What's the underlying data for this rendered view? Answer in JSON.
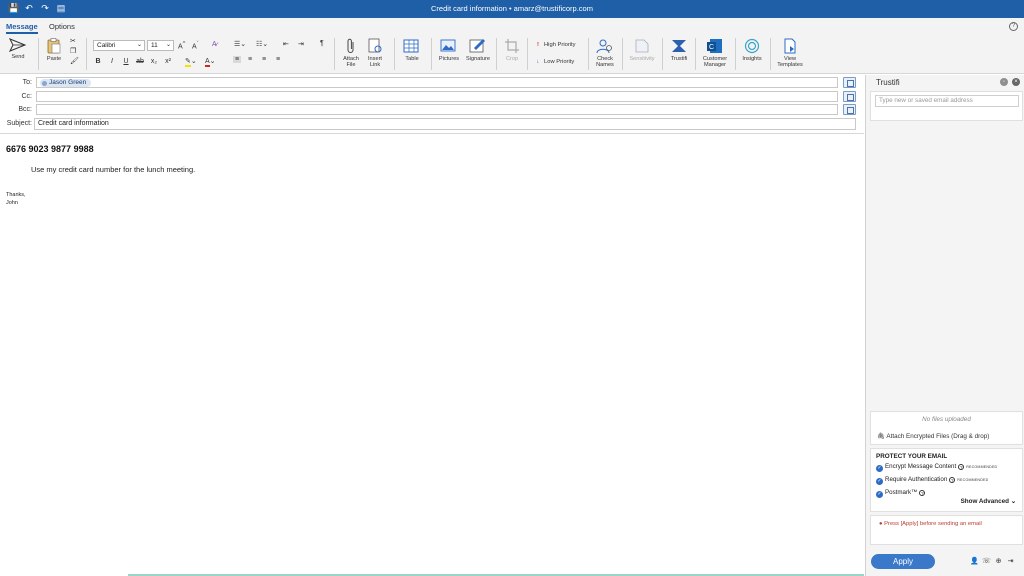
{
  "window": {
    "title": "Credit card information • amarz@trustificorp.com",
    "quick_access": [
      "save-icon",
      "undo-icon",
      "redo-icon",
      "draft-icon"
    ]
  },
  "tabs": [
    {
      "label": "Message",
      "active": true
    },
    {
      "label": "Options",
      "active": false
    }
  ],
  "ribbon": {
    "send": "Send",
    "paste": "Paste",
    "font_name": "Calibri",
    "font_size": "11",
    "format_buttons": [
      "B",
      "I",
      "U",
      "ab",
      "x₂",
      "x²"
    ],
    "attach_file": [
      "Attach",
      "File"
    ],
    "insert_link": [
      "Insert",
      "Link"
    ],
    "table": "Table",
    "pictures": "Pictures",
    "signature": "Signature",
    "crop": "Crop",
    "high_priority": "High Priority",
    "low_priority": "Low Priority",
    "check_names": [
      "Check",
      "Names"
    ],
    "sensitivity": "Sensitivity",
    "trustifi": "Trustifi",
    "customer_manager": [
      "Customer",
      "Manager"
    ],
    "insights": "Insights",
    "view_templates": [
      "View",
      "Templates"
    ]
  },
  "compose": {
    "to_label": "To:",
    "cc_label": "Cc:",
    "bcc_label": "Bcc:",
    "subject_label": "Subject:",
    "to_recipient": "Jason Green",
    "subject_value": "Credit card information",
    "card_number": "6676 9023 9877 9988",
    "message_line": "Use my credit card number for the lunch meeting.",
    "sign_off": [
      "Thanks,",
      "John"
    ]
  },
  "panel": {
    "title": "Trustifi",
    "email_placeholder": "Type new or saved email address",
    "no_files": "No files uploaded",
    "attach_encrypted": "Attach Encrypted Files",
    "attach_hint": "(Drag & drop)",
    "protect_heading": "PROTECT YOUR EMAIL",
    "encrypt": "Encrypt Message Content",
    "require_auth": "Require Authentication",
    "postmark": "Postmark™",
    "recommended": "RECOMMENDED",
    "show_advanced": "Show Advanced",
    "warning": "Press [Apply] before sending an email",
    "apply": "Apply"
  },
  "colors": {
    "titlebar": "#1f5fa8",
    "accent": "#2d6bc4",
    "apply_button": "#3a78c9",
    "warning": "#c0392b"
  }
}
